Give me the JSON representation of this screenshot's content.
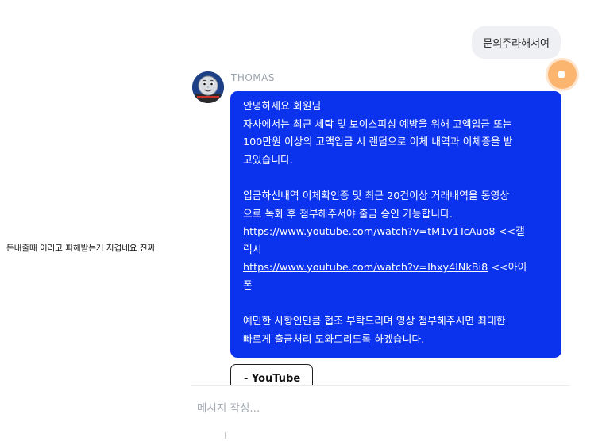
{
  "side_caption": "돈내줄때 이러고 피해받는거 지겹네요 진짜",
  "user_message": {
    "text": "문의주라해서여"
  },
  "agent": {
    "name": "THOMAS",
    "avatar": "thomas-tank-engine-avatar"
  },
  "agent_message": {
    "lines": [
      "안녕하세요 회원님",
      "자사에서는 최근 세탁 및 보이스피싱 예방을 위해 고액입금 또는",
      "100만원 이상의 고액입금 시 랜덤으로 이체 내역과 이체증을 받",
      "고있습니다.",
      "입금하신내역 이체확인증 및 최근 20건이상 거래내역을 동영상",
      "으로 녹화 후 첨부해주서야 출금 승인 가능합니다."
    ],
    "link1": {
      "url": "https://www.youtube.com/watch?v=tM1v1TcAuo8",
      "suffix": " <<갤",
      "suffix_wrap": "럭시"
    },
    "link2": {
      "url": "https://www.youtube.com/watch?v=Ihxy4lNkBi8",
      "suffix": " <<아이",
      "suffix_wrap": "폰"
    },
    "closing_lines": [
      "예민한 사항인만큼 협조 부탁드리며 영상 첨부해주시면 최대한",
      "빠르게 출금처리 도와드리도록 하겠습니다."
    ]
  },
  "link_preview": {
    "label": "- YouTube"
  },
  "composer": {
    "placeholder": "메시지 작성..."
  },
  "colors": {
    "bubble_blue": "#0b33ee",
    "user_bubble": "#eef0f3",
    "fab_orange": "#fbb56f"
  }
}
